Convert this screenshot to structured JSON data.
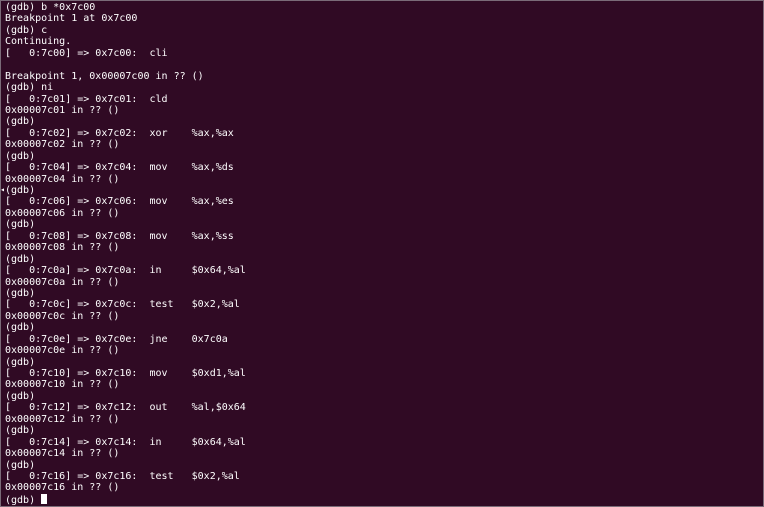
{
  "colors": {
    "background": "#300a24",
    "text": "#ffffff"
  },
  "terminal": {
    "lines": [
      "(gdb) b *0x7c00",
      "Breakpoint 1 at 0x7c00",
      "(gdb) c",
      "Continuing.",
      "[   0:7c00] => 0x7c00:  cli",
      "",
      "Breakpoint 1, 0x00007c00 in ?? ()",
      "(gdb) ni",
      "[   0:7c01] => 0x7c01:  cld",
      "0x00007c01 in ?? ()",
      "(gdb)",
      "[   0:7c02] => 0x7c02:  xor    %ax,%ax",
      "0x00007c02 in ?? ()",
      "(gdb)",
      "[   0:7c04] => 0x7c04:  mov    %ax,%ds",
      "0x00007c04 in ?? ()",
      "(gdb)",
      "[   0:7c06] => 0x7c06:  mov    %ax,%es",
      "0x00007c06 in ?? ()",
      "(gdb)",
      "[   0:7c08] => 0x7c08:  mov    %ax,%ss",
      "0x00007c08 in ?? ()",
      "(gdb)",
      "[   0:7c0a] => 0x7c0a:  in     $0x64,%al",
      "0x00007c0a in ?? ()",
      "(gdb)",
      "[   0:7c0c] => 0x7c0c:  test   $0x2,%al",
      "0x00007c0c in ?? ()",
      "(gdb)",
      "[   0:7c0e] => 0x7c0e:  jne    0x7c0a",
      "0x00007c0e in ?? ()",
      "(gdb)",
      "[   0:7c10] => 0x7c10:  mov    $0xd1,%al",
      "0x00007c10 in ?? ()",
      "(gdb)",
      "[   0:7c12] => 0x7c12:  out    %al,$0x64",
      "0x00007c12 in ?? ()",
      "(gdb)",
      "[   0:7c14] => 0x7c14:  in     $0x64,%al",
      "0x00007c14 in ?? ()",
      "(gdb)",
      "[   0:7c16] => 0x7c16:  test   $0x2,%al",
      "0x00007c16 in ?? ()"
    ],
    "prompt": "(gdb) ",
    "side_marker": "◂"
  }
}
